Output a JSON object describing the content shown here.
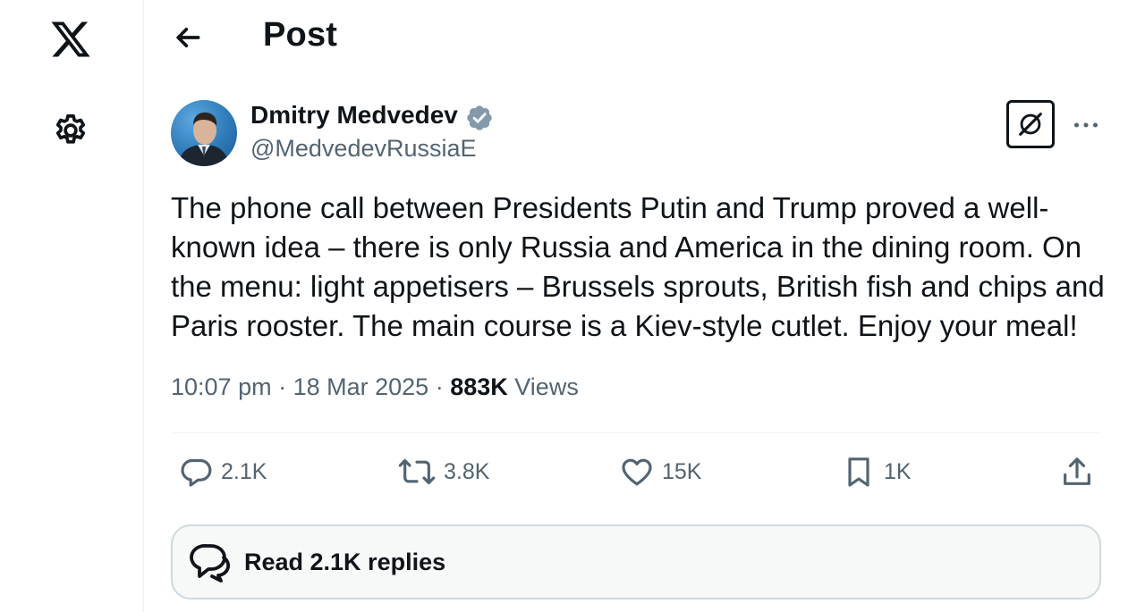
{
  "nav": {
    "logo_icon": "x-logo-icon",
    "settings_icon": "gear-icon"
  },
  "header": {
    "back_icon": "arrow-left-icon",
    "title": "Post"
  },
  "author": {
    "name": "Dmitry Medvedev",
    "handle": "@MedvedevRussiaE",
    "verified_icon": "verified-badge-icon",
    "verified_color": "#829aab"
  },
  "actions_top": {
    "grok_icon": "grok-icon",
    "more_icon": "more-horizontal-icon"
  },
  "post": {
    "text": "The phone call between Presidents Putin and Trump proved a well-known idea – there is only Russia and America in the dining room. On the menu: light appetisers – Brussels sprouts, British fish and chips and Paris rooster. The main course is a Kiev-style cutlet. Enjoy your meal!",
    "time": "10:07 pm",
    "date": "18 Mar 2025",
    "views_count": "883K",
    "views_label": "Views"
  },
  "engagement": {
    "replies": "2.1K",
    "reposts": "3.8K",
    "likes": "15K",
    "bookmarks": "1K",
    "share_icon": "share-icon"
  },
  "read_replies": {
    "label": "Read 2.1K replies",
    "icon": "chat-bubbles-icon"
  },
  "colors": {
    "text_primary": "#0f1419",
    "text_secondary": "#536471",
    "border": "#eff3f4",
    "button_border": "#cfd9de",
    "button_bg": "#f7f9f9"
  }
}
